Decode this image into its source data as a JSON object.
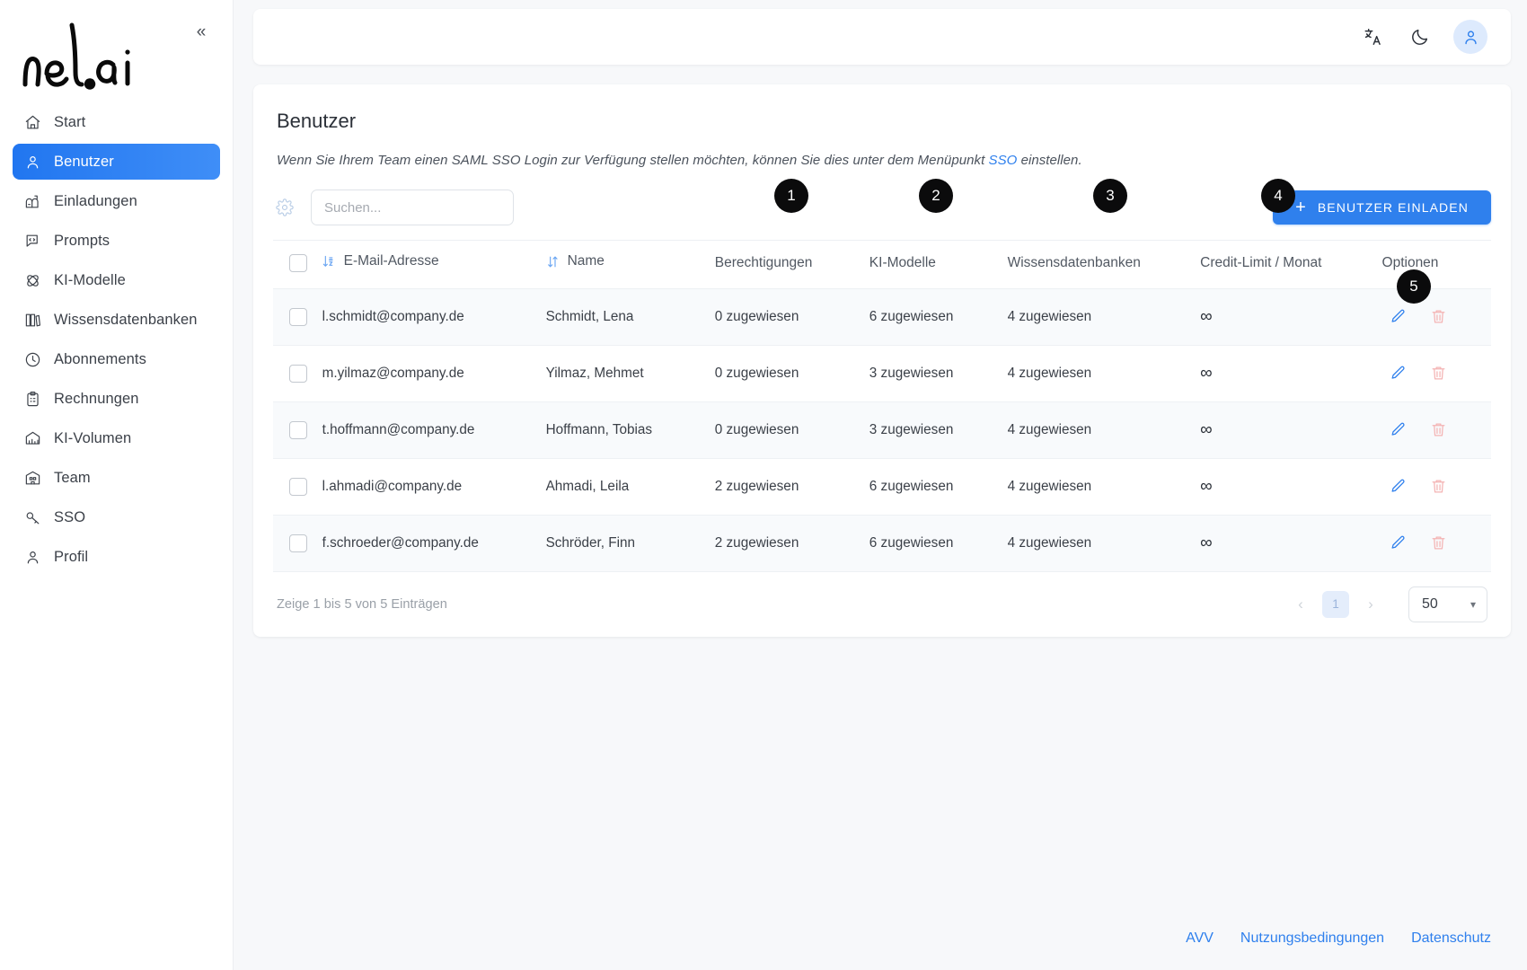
{
  "sidebar": {
    "logo_text": "nele.ai",
    "collapse_icon": "chevrons-left-icon",
    "items": [
      {
        "label": "Start",
        "icon": "home-icon",
        "active": false
      },
      {
        "label": "Benutzer",
        "icon": "user-icon",
        "active": true
      },
      {
        "label": "Einladungen",
        "icon": "mailbox-icon",
        "active": false
      },
      {
        "label": "Prompts",
        "icon": "message-code-icon",
        "active": false
      },
      {
        "label": "KI-Modelle",
        "icon": "atom-icon",
        "active": false
      },
      {
        "label": "Wissensdatenbanken",
        "icon": "books-icon",
        "active": false
      },
      {
        "label": "Abonnements",
        "icon": "clock-icon",
        "active": false
      },
      {
        "label": "Rechnungen",
        "icon": "clipboard-icon",
        "active": false
      },
      {
        "label": "KI-Volumen",
        "icon": "chart-icon",
        "active": false
      },
      {
        "label": "Team",
        "icon": "building-icon",
        "active": false
      },
      {
        "label": "SSO",
        "icon": "key-icon",
        "active": false
      },
      {
        "label": "Profil",
        "icon": "profile-icon",
        "active": false
      }
    ]
  },
  "topbar": {
    "translate_icon": "translate-icon",
    "theme_icon": "moon-icon",
    "avatar_icon": "user-avatar-icon"
  },
  "page": {
    "title": "Benutzer",
    "subtitle_before": "Wenn Sie Ihrem Team einen SAML SSO Login zur Verfügung stellen möchten, können Sie dies unter dem Menüpunkt ",
    "subtitle_link": "SSO",
    "subtitle_after": " einstellen."
  },
  "toolbar": {
    "settings_icon": "gear-icon",
    "search_placeholder": "Suchen...",
    "search_value": "",
    "invite_label": "BENUTZER EINLADEN",
    "invite_plus": "+"
  },
  "table": {
    "columns": [
      {
        "key": "checkbox",
        "label": "",
        "sort": ""
      },
      {
        "key": "email",
        "label": "E-Mail-Adresse",
        "sort": "sort-alpha-down-icon"
      },
      {
        "key": "name",
        "label": "Name",
        "sort": "sort-updown-icon"
      },
      {
        "key": "permissions",
        "label": "Berechtigungen",
        "sort": ""
      },
      {
        "key": "models",
        "label": "KI-Modelle",
        "sort": ""
      },
      {
        "key": "knowledge",
        "label": "Wissensdatenbanken",
        "sort": ""
      },
      {
        "key": "credit",
        "label": "Credit-Limit / Monat",
        "sort": ""
      },
      {
        "key": "options",
        "label": "Optionen",
        "sort": ""
      }
    ],
    "rows": [
      {
        "email": "l.schmidt@company.de",
        "name": "Schmidt, Lena",
        "permissions": "0 zugewiesen",
        "models": "6 zugewiesen",
        "knowledge": "4 zugewiesen",
        "credit": "∞"
      },
      {
        "email": "m.yilmaz@company.de",
        "name": "Yilmaz, Mehmet",
        "permissions": "0 zugewiesen",
        "models": "3 zugewiesen",
        "knowledge": "4 zugewiesen",
        "credit": "∞"
      },
      {
        "email": "t.hoffmann@company.de",
        "name": "Hoffmann, Tobias",
        "permissions": "0 zugewiesen",
        "models": "3 zugewiesen",
        "knowledge": "4 zugewiesen",
        "credit": "∞"
      },
      {
        "email": "l.ahmadi@company.de",
        "name": "Ahmadi, Leila",
        "permissions": "2 zugewiesen",
        "models": "6 zugewiesen",
        "knowledge": "4 zugewiesen",
        "credit": "∞"
      },
      {
        "email": "f.schroeder@company.de",
        "name": "Schröder, Finn",
        "permissions": "2 zugewiesen",
        "models": "6 zugewiesen",
        "knowledge": "4 zugewiesen",
        "credit": "∞"
      }
    ],
    "row_actions": {
      "edit_icon": "pencil-icon",
      "delete_icon": "trash-icon"
    }
  },
  "footer": {
    "entries_info": "Zeige 1 bis 5 von 5 Einträgen",
    "prev_icon": "chevron-left-icon",
    "next_icon": "chevron-right-icon",
    "current_page": "1",
    "page_size": "50",
    "page_size_chevron": "chevron-down-icon"
  },
  "badges": [
    {
      "number": "1"
    },
    {
      "number": "2"
    },
    {
      "number": "3"
    },
    {
      "number": "4"
    },
    {
      "number": "5"
    }
  ],
  "legal_links": [
    {
      "label": "AVV"
    },
    {
      "label": "Nutzungsbedingungen"
    },
    {
      "label": "Datenschutz"
    }
  ],
  "colors": {
    "accent": "#2f80ed",
    "active_nav": "#2176f0",
    "badge_bg": "#0b0b0c",
    "danger": "#f4b4b4",
    "page_bg": "#f7f8fa"
  }
}
